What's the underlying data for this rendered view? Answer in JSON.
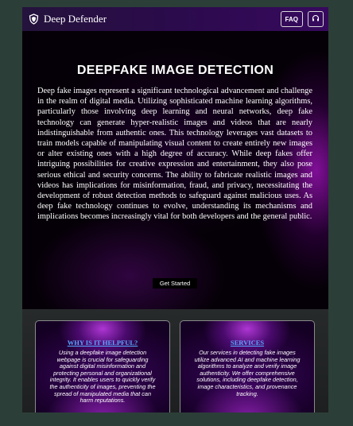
{
  "header": {
    "brand": "Deep Defender",
    "faq_label": "FAQ",
    "support_icon": "headset-icon",
    "brand_icon": "shield-icon"
  },
  "hero": {
    "title": "DEEPFAKE IMAGE DETECTION",
    "body": "Deep fake images represent a significant technological advancement and challenge in the realm of digital media. Utilizing sophisticated machine learning algorithms, particularly those involving deep learning and neural networks, deep fake technology can generate hyper-realistic images and videos that are nearly indistinguishable from authentic ones. This technology leverages vast datasets to train models capable of manipulating visual content to create entirely new images or alter existing ones with a high degree of accuracy. While deep fakes offer intriguing possibilities for creative expression and entertainment, they also pose serious ethical and security concerns. The ability to fabricate realistic images and videos has implications for misinformation, fraud, and privacy, necessitating the development of robust detection methods to safeguard against malicious uses. As deep fake technology continues to evolve, understanding its mechanisms and implications becomes increasingly vital for both developers and the general public.",
    "cta_label": "Get Started"
  },
  "cards": [
    {
      "title": "WHY IS IT HELPFUL?",
      "text": "Using a deepfake image detection webpage is crucial for safeguarding against digital misinformation and protecting personal and organizational integrity. It enables users to quickly verify the authenticity of images, preventing the spread of manipulated media that can harm reputations."
    },
    {
      "title": "SERVICES",
      "text": "Our services in detecting fake images utilize advanced AI and machine learning algorithms to analyze and verify image authenticity. We offer comprehensive solutions, including deepfake detection, image characteristics, and provenance tracking."
    }
  ],
  "colors": {
    "page_background": "#2c3e38",
    "nav_accent": "#37095e",
    "card_title": "#55aaff",
    "glow": "#aa14c8"
  }
}
